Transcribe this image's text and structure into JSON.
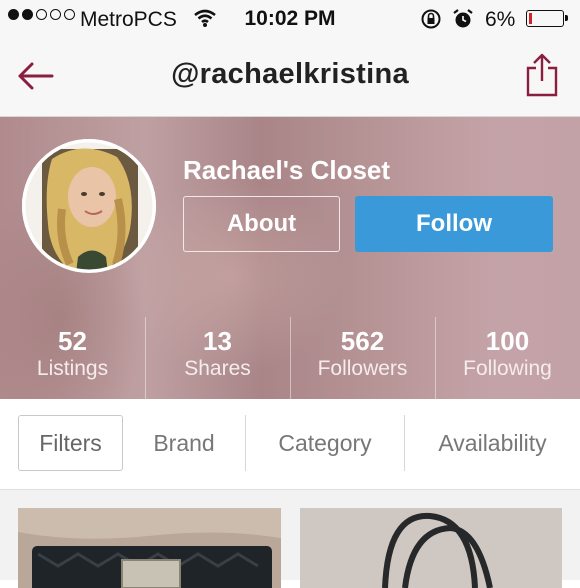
{
  "status_bar": {
    "carrier": "MetroPCS",
    "time": "10:02 PM",
    "battery_percent": "6%",
    "battery_level": 0.06,
    "signal_bars_filled": 2,
    "signal_bars_total": 5,
    "icons": [
      "wifi-icon",
      "rotation-lock-icon",
      "alarm-icon",
      "battery-icon"
    ]
  },
  "nav": {
    "title": "@rachaelkristina",
    "back_icon": "back-arrow-icon",
    "share_icon": "share-icon",
    "accent_color": "#8b1e3f"
  },
  "profile": {
    "closet_name": "Rachael's Closet",
    "about_label": "About",
    "follow_label": "Follow",
    "follow_color": "#3a9ad9",
    "stats": [
      {
        "value": "52",
        "label": "Listings"
      },
      {
        "value": "13",
        "label": "Shares"
      },
      {
        "value": "562",
        "label": "Followers"
      },
      {
        "value": "100",
        "label": "Following"
      }
    ]
  },
  "filters": {
    "filters_label": "Filters",
    "tabs": [
      "Brand",
      "Category",
      "Availability"
    ]
  },
  "listings": [
    {
      "type": "wallet-photo"
    },
    {
      "type": "handbag-photo"
    }
  ]
}
